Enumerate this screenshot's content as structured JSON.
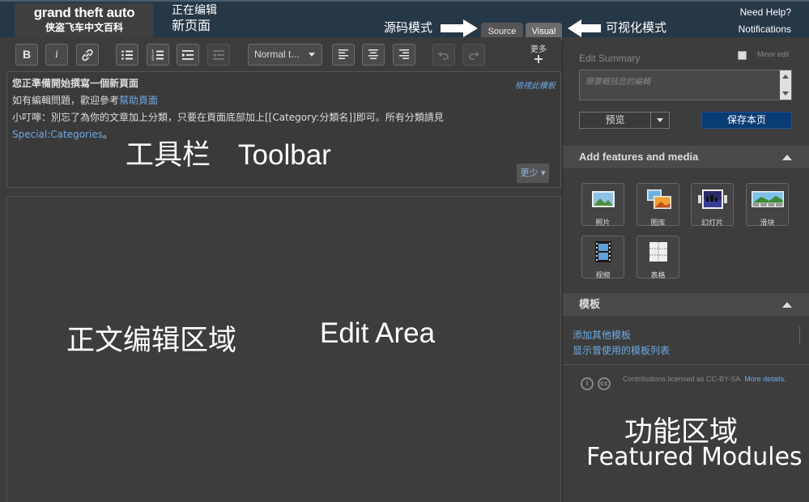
{
  "header": {
    "logo_line1": "grand theft auto",
    "logo_line2": "侠盗飞车中文百科",
    "edit_label": "正在编辑",
    "page_name": "新页面",
    "help": "Need Help?",
    "notifications": "Notifications",
    "tabs": [
      {
        "label": "Source"
      },
      {
        "label": "Visual"
      }
    ],
    "annotation_source": "源码模式",
    "annotation_visual": "可视化模式"
  },
  "toolbar": {
    "bold": "B",
    "italic": "i",
    "format_value": "Normal t...",
    "more_label": "更多",
    "more_plus": "+",
    "icons": [
      "bold-icon",
      "italic-icon",
      "link-icon",
      "bullet-list-icon",
      "numbered-list-icon",
      "indent-icon",
      "outdent-icon",
      "align-left-icon",
      "align-center-icon",
      "align-right-icon",
      "undo-icon",
      "redo-icon"
    ]
  },
  "notice": {
    "title": "您正準備開始撰寫一個新頁面",
    "line2_prefix": "如有編輯問題，歡迎參考",
    "line2_link": "幫助頁面",
    "line3": "小叮嚀：別忘了為你的文章加上分類，只要在頁面底部加上[[Category:分類名]]即可。所有分類請見",
    "line4_link": "Special:Categories",
    "line4_suffix": "。",
    "view_template": "檢視此模板",
    "less_button": "更少"
  },
  "annotations": {
    "toolbar_cn": "工具栏",
    "toolbar_en": "Toolbar",
    "edit_cn": "正文编辑区域",
    "edit_en": "Edit Area",
    "feature_cn": "功能区域",
    "feature_en": "Featured Modules"
  },
  "right_panel": {
    "summary_label": "Edit Summary",
    "minor_edit_label": "Minor edit",
    "summary_placeholder": "簡要概括您的編輯",
    "preview_button": "预览",
    "save_button": "保存本页",
    "media_section_title": "Add features and media",
    "media_buttons": [
      {
        "label": "照片",
        "icon": "photo-icon"
      },
      {
        "label": "图库",
        "icon": "gallery-icon"
      },
      {
        "label": "幻灯片",
        "icon": "slideshow-icon"
      },
      {
        "label": "滑块",
        "icon": "slider-icon"
      },
      {
        "label": "视频",
        "icon": "video-icon"
      },
      {
        "label": "表格",
        "icon": "table-icon"
      }
    ],
    "templates_section_title": "模板",
    "template_add": "添加其他模板",
    "template_list": "显示曾使用的模板列表",
    "license_text": "Contributions licensed as CC-BY-SA.",
    "license_more": "More details."
  },
  "colors": {
    "header_bg": "#263746",
    "save_button_bg": "#0a3c74",
    "link": "#6ea9e6"
  }
}
